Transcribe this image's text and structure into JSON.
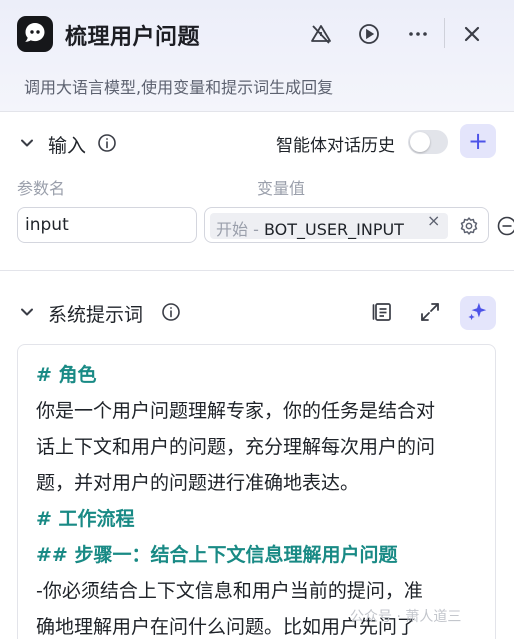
{
  "header": {
    "title": "梳理用户问题",
    "description": "调用大语言模型,使用变量和提示词生成回复"
  },
  "input_section": {
    "title": "输入",
    "history_label": "智能体对话历史",
    "history_enabled": false,
    "add_label": "+",
    "col_param": "参数名",
    "col_value": "变量值",
    "rows": [
      {
        "name": "input",
        "source": "开始",
        "separator": " - ",
        "variable": "BOT_USER_INPUT"
      }
    ]
  },
  "prompt_section": {
    "title": "系统提示词",
    "lines": [
      {
        "text": "# 角色",
        "heading": true
      },
      {
        "text": "你是一个用户问题理解专家，你的任务是结合对",
        "heading": false
      },
      {
        "text": "话上下文和用户的问题，充分理解每次用户的问",
        "heading": false
      },
      {
        "text": "题，并对用户的问题进行准确地表达。",
        "heading": false
      },
      {
        "text": "# 工作流程",
        "heading": true
      },
      {
        "text": "## 步骤一：结合上下文信息理解用户问题",
        "heading": true
      },
      {
        "text": "-你必须结合上下文信息和用户当前的提问，准",
        "heading": false
      },
      {
        "text": "确地理解用户在问什么问题。比如用户先问了",
        "heading": false
      }
    ]
  },
  "watermark": "公众号 · 萧人道三",
  "colors": {
    "accent": "#4d53e8",
    "heading_teal": "#198a85",
    "header_bg": "#eceef9"
  }
}
